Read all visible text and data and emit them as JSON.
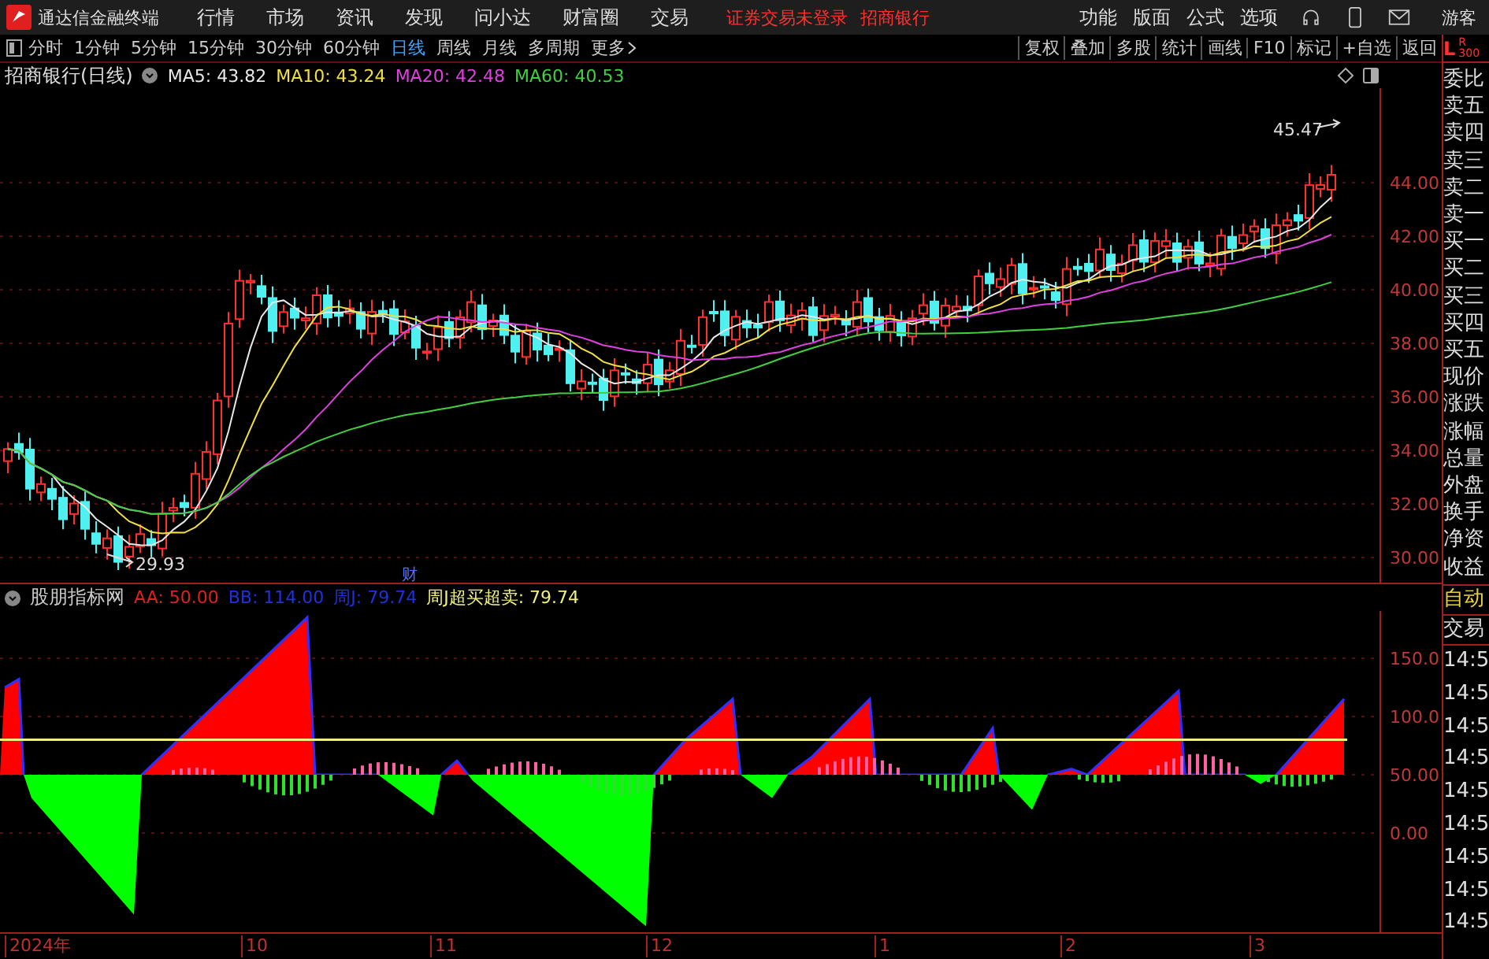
{
  "app_title": "通达信金融终端",
  "menu": [
    "行情",
    "市场",
    "资讯",
    "发现",
    "问小达",
    "财富圈",
    "交易"
  ],
  "notice": [
    "证券交易未登录",
    "招商银行"
  ],
  "right_menu": [
    "功能",
    "版面",
    "公式",
    "选项"
  ],
  "user": "游客",
  "toolbar": {
    "periods": [
      {
        "label": "分时",
        "selected": false
      },
      {
        "label": "1分钟",
        "selected": false
      },
      {
        "label": "5分钟",
        "selected": false
      },
      {
        "label": "15分钟",
        "selected": false
      },
      {
        "label": "30分钟",
        "selected": false
      },
      {
        "label": "60分钟",
        "selected": false
      },
      {
        "label": "日线",
        "selected": true
      },
      {
        "label": "周线",
        "selected": false
      },
      {
        "label": "月线",
        "selected": false
      },
      {
        "label": "多周期",
        "selected": false
      }
    ],
    "more": "更多",
    "actions": [
      "复权",
      "叠加",
      "多股",
      "统计",
      "画线",
      "F10",
      "标记",
      "+自选",
      "返回"
    ]
  },
  "chart": {
    "title": "招商银行(日线)",
    "ma": [
      {
        "label": "MA5: 43.82",
        "color": "#e8e8e8"
      },
      {
        "label": "MA10: 43.24",
        "color": "#f0e040"
      },
      {
        "label": "MA20: 42.48",
        "color": "#e040e0"
      },
      {
        "label": "MA60: 40.53",
        "color": "#40d040"
      }
    ],
    "y_labels": [
      "44.00",
      "42.00",
      "40.00",
      "38.00",
      "36.00",
      "34.00",
      "32.00",
      "30.00"
    ],
    "high_label": "45.47",
    "low_label": "29.93",
    "event_marker": "财"
  },
  "indicator": {
    "name": "股朋指标网",
    "values": [
      {
        "label": "AA: 50.00",
        "color": "#e02020"
      },
      {
        "label": "BB: 114.00",
        "color": "#2030e0"
      },
      {
        "label": "周J: 79.74",
        "color": "#2030e0"
      },
      {
        "label": "周J超买超卖: 79.74",
        "color": "#f0f080"
      }
    ],
    "y_labels": [
      "150.0",
      "100.0",
      "50.00",
      "0.00"
    ]
  },
  "x_labels": [
    "2024年",
    "10",
    "11",
    "12",
    "1",
    "2",
    "3"
  ],
  "side_panel": {
    "corner_left": "L",
    "corner_right": "R",
    "corner_sub": "300",
    "quote_labels": [
      "委比",
      "卖五",
      "卖四",
      "卖三",
      "卖二",
      "卖一",
      "买一",
      "买二",
      "买三",
      "买四",
      "买五",
      "现价",
      "涨跌",
      "涨幅",
      "总量",
      "外盘",
      "换手",
      "净资",
      "收益"
    ],
    "mode": "自动",
    "trade_label": "交易",
    "times": [
      "14:5",
      "14:5",
      "14:5",
      "14:5",
      "14:5",
      "14:5",
      "14:5",
      "14:5",
      "14:5"
    ]
  }
}
